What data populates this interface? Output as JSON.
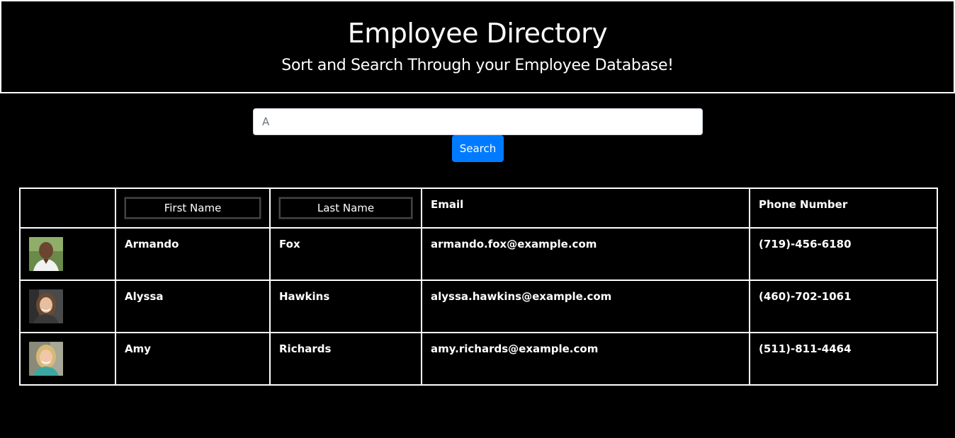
{
  "header": {
    "title": "Employee Directory",
    "subtitle": "Sort and Search Through your Employee Database!"
  },
  "search": {
    "placeholder": "A",
    "value": "",
    "button_label": "Search",
    "button_color": "#007bff"
  },
  "table": {
    "headers": {
      "image": "",
      "first_name": "First Name",
      "last_name": "Last Name",
      "email": "Email",
      "phone": "Phone Number"
    },
    "rows": [
      {
        "avatar_icon": "person-avatar-icon",
        "first_name": "Armando",
        "last_name": "Fox",
        "email": "armando.fox@example.com",
        "phone": "(719)-456-6180"
      },
      {
        "avatar_icon": "person-avatar-icon",
        "first_name": "Alyssa",
        "last_name": "Hawkins",
        "email": "alyssa.hawkins@example.com",
        "phone": "(460)-702-1061"
      },
      {
        "avatar_icon": "person-avatar-icon",
        "first_name": "Amy",
        "last_name": "Richards",
        "email": "amy.richards@example.com",
        "phone": "(511)-811-4464"
      }
    ]
  }
}
